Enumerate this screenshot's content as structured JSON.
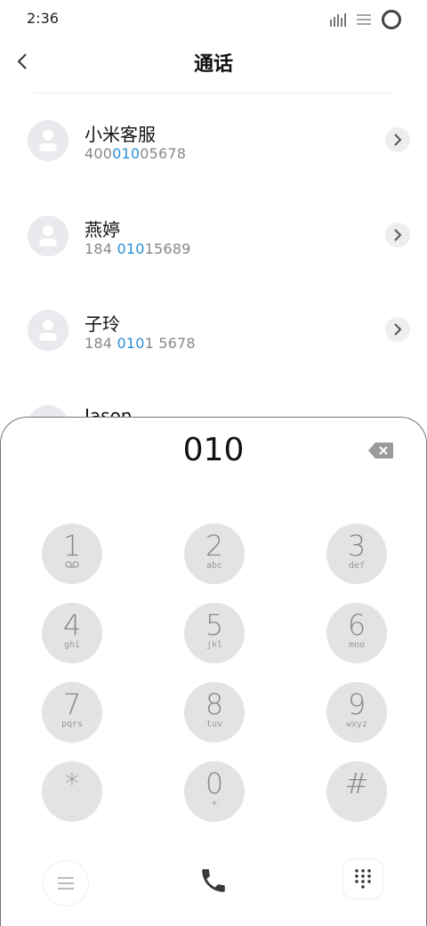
{
  "status": {
    "time": "2:36"
  },
  "header": {
    "title": "通话"
  },
  "contacts": [
    {
      "name": "小米客服",
      "num_pre": "400",
      "num_hl": "010",
      "num_post": "05678"
    },
    {
      "name": "燕婷",
      "num_pre": "184 ",
      "num_hl": "010",
      "num_post": "15689"
    },
    {
      "name": "子玲",
      "num_pre": "184 ",
      "num_hl": "010",
      "num_post": "1 5678"
    },
    {
      "name": "Jason",
      "num_pre": "",
      "num_hl": "",
      "num_post": ""
    }
  ],
  "dialer": {
    "display": "010",
    "keys": [
      {
        "digit": "1",
        "letters": ""
      },
      {
        "digit": "2",
        "letters": "abc"
      },
      {
        "digit": "3",
        "letters": "def"
      },
      {
        "digit": "4",
        "letters": "ghi"
      },
      {
        "digit": "5",
        "letters": "jkl"
      },
      {
        "digit": "6",
        "letters": "mno"
      },
      {
        "digit": "7",
        "letters": "pqrs"
      },
      {
        "digit": "8",
        "letters": "tuv"
      },
      {
        "digit": "9",
        "letters": "wxyz"
      },
      {
        "digit": "*",
        "letters": ""
      },
      {
        "digit": "0",
        "letters": "+"
      },
      {
        "digit": "#",
        "letters": ""
      }
    ]
  },
  "icons": {
    "back": "back-chevron-icon",
    "chevron": "chevron-right-icon",
    "backspace": "backspace-icon",
    "voicemail": "voicemail-icon",
    "menu": "menu-icon",
    "call": "phone-icon",
    "keypad": "keypad-icon"
  },
  "colors": {
    "highlight": "#2a8fd8",
    "key_bg": "#e3e3e3",
    "call": "#3a3a3a"
  }
}
